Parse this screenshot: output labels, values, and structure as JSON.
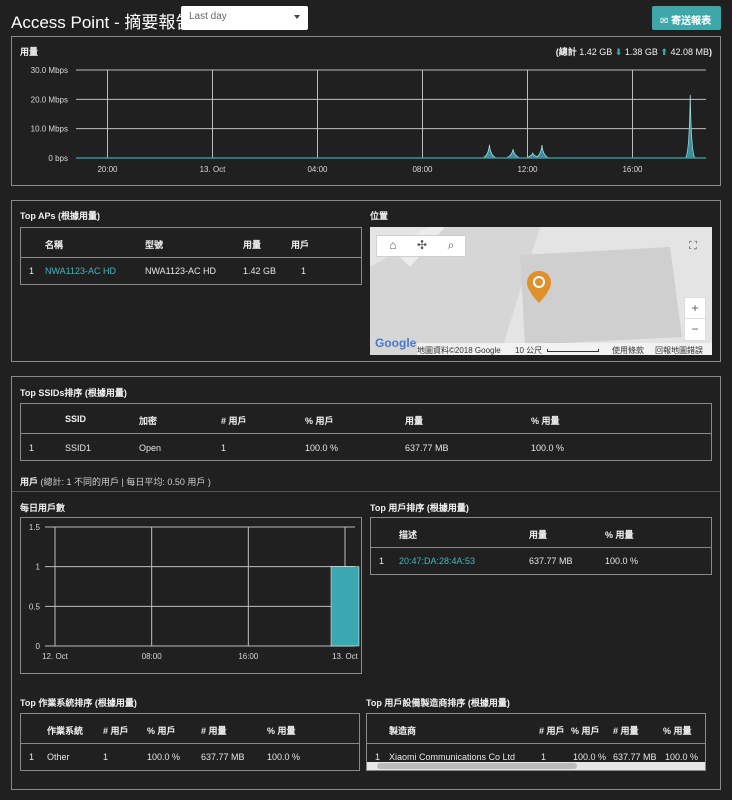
{
  "header": {
    "title": "Access Point - 摘要報告",
    "range_selected": "Last day",
    "report_button": "寄送報表"
  },
  "usage": {
    "label": "用量",
    "summary_prefix": "(總計",
    "total": "1.42 GB",
    "down": "1.38 GB",
    "up": "42.08 MB",
    "summary_suffix": ")"
  },
  "chart_data": [
    {
      "type": "area",
      "title": "",
      "y_ticks": [
        "0 bps",
        "10.0 Mbps",
        "20.0 Mbps",
        "30.0 Mbps"
      ],
      "x_ticks": [
        "20:00",
        "13. Oct",
        "04:00",
        "08:00",
        "12:00",
        "16:00"
      ],
      "ylim": [
        0,
        30
      ],
      "y_unit": "Mbps",
      "x_hours": [
        0,
        4,
        8,
        12,
        16,
        20
      ],
      "peaks": [
        {
          "hour": 15.75,
          "value": 4.5
        },
        {
          "hour": 16.65,
          "value": 3.0
        },
        {
          "hour": 17.4,
          "value": 1.6
        },
        {
          "hour": 17.75,
          "value": 4.4
        },
        {
          "hour": 23.4,
          "value": 21.5
        }
      ],
      "grid": true
    },
    {
      "type": "bar",
      "title": "",
      "categories": [
        "12. Oct",
        "08:00",
        "16:00",
        "13. Oct"
      ],
      "y_ticks": [
        "0",
        "0.5",
        "1",
        "1.5"
      ],
      "ylim": [
        0,
        1.5
      ],
      "values": [
        0,
        0,
        0,
        1
      ],
      "grid": true,
      "color": "#3aa8b0"
    }
  ],
  "top_aps": {
    "label": "Top APs (根據用量)",
    "columns": [
      "名稱",
      "型號",
      "用量",
      "用戶"
    ],
    "rows": [
      {
        "rank": "1",
        "name": "NWA1123-AC HD",
        "model": "NWA1123-AC HD",
        "usage": "1.42 GB",
        "users": "1"
      }
    ]
  },
  "location": {
    "label": "位置",
    "footer_data": "地圖資料©2018 Google",
    "footer_scale": "10 公尺",
    "footer_terms": "使用條款",
    "footer_report": "回報地圖錯誤",
    "logo": "Google"
  },
  "top_ssids": {
    "label": "Top SSIDs排序 (根據用量)",
    "columns": [
      "SSID",
      "加密",
      "# 用戶",
      "% 用戶",
      "用量",
      "% 用量"
    ],
    "rows": [
      {
        "rank": "1",
        "ssid": "SSID1",
        "enc": "Open",
        "users": "1",
        "pct_users": "100.0 %",
        "usage": "637.77 MB",
        "pct_usage": "100.0 %"
      }
    ]
  },
  "users": {
    "label": "用戶",
    "summary": "(總計: 1 不同的用戶 | 每日平均: 0.50 用戶 )"
  },
  "daily_users": {
    "label": "每日用戶數"
  },
  "top_users": {
    "label": "Top 用戶排序 (根據用量)",
    "columns": [
      "描述",
      "用量",
      "% 用量"
    ],
    "rows": [
      {
        "rank": "1",
        "desc": "20:47:DA:28:4A:53",
        "usage": "637.77 MB",
        "pct": "100.0 %"
      }
    ]
  },
  "top_os": {
    "label": "Top 作業系統排序 (根據用量)",
    "columns": [
      "作業系統",
      "# 用戶",
      "% 用戶",
      "# 用量",
      "% 用量"
    ],
    "rows": [
      {
        "rank": "1",
        "os": "Other",
        "users": "1",
        "pct_users": "100.0 %",
        "usage": "637.77 MB",
        "pct_usage": "100.0 %"
      }
    ]
  },
  "top_vendors": {
    "label": "Top 用戶設備製造商排序 (根據用量)",
    "columns": [
      "製造商",
      "# 用戶",
      "% 用戶",
      "# 用量",
      "% 用量"
    ],
    "rows": [
      {
        "rank": "1",
        "vendor": "Xiaomi Communications Co Ltd",
        "users": "1",
        "pct_users": "100.0 %",
        "usage": "637.77 MB",
        "pct_usage": "100.0 %"
      }
    ]
  },
  "colors": {
    "accent": "#3ea7a9",
    "link": "#47b4c0",
    "pin": "#e0902a",
    "area_fill": "#3a8f9a"
  }
}
